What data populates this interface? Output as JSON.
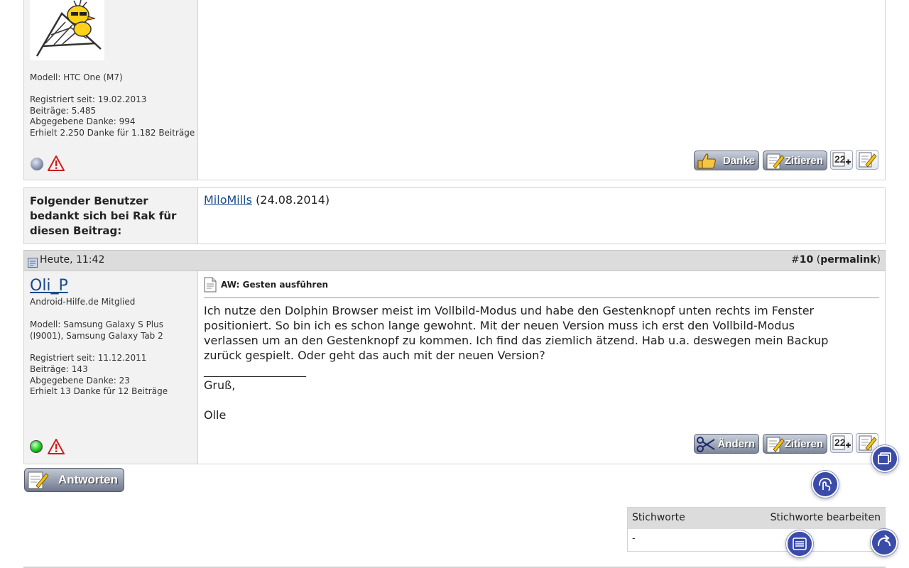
{
  "post_prev": {
    "info": {
      "model": "Modell: HTC One (M7)",
      "registered": "Registriert seit: 19.02.2013",
      "posts": "Beiträge: 5.485",
      "given_thanks": "Abgegebene Danke: 994",
      "received_thanks": "Erhielt 2.250 Danke für 1.182 Beiträge"
    },
    "buttons": {
      "thanks": "Danke",
      "quote": "Zitieren"
    }
  },
  "thanks_box": {
    "label": "Folgender Benutzer bedankt sich bei Rak für diesen Beitrag:",
    "user": "MiloMills",
    "date": "(24.08.2014)"
  },
  "post": {
    "date": "Heute, 11:42",
    "number_prefix": "#",
    "number": "10",
    "permalink_open": "(",
    "permalink": "permalink",
    "permalink_close": ")",
    "username": "Oli_P",
    "rank": "Android-Hilfe.de Mitglied",
    "info": {
      "model_line1": "Modell: Samsung Galaxy S Plus",
      "model_line2": "(I9001), Samsung Galaxy Tab 2",
      "registered": "Registriert seit: 11.12.2011",
      "posts": "Beiträge: 143",
      "given_thanks": "Abgegebene Danke: 23",
      "received_thanks": "Erhielt 13 Danke für 12 Beiträge"
    },
    "title": "AW: Gesten ausführen",
    "body": "Ich nutze den Dolphin Browser meist im Vollbild-Modus und habe den Gestenknopf unten rechts im Fenster positioniert. So bin ich es schon lange gewohnt. Mit der neuen Version muss ich erst den Vollbild-Modus verlassen um an den Gestenknopf zu kommen. Ich find das ziemlich ätzend. Hab u.a. deswegen mein Backup zurück gespielt. Oder geht das auch mit der neuen Version?",
    "signature_line": "__________________",
    "signature_greeting": "Gruß,",
    "signature_name": "Olle",
    "buttons": {
      "edit": "Ändern",
      "quote": "Zitieren"
    }
  },
  "reply_button": "Antworten",
  "tags": {
    "header": "Stichworte",
    "edit_link": "Stichworte bearbeiten",
    "value": "-"
  },
  "icons": {
    "status_offline": "offline-status-icon",
    "status_online": "online-status-icon",
    "report": "report-warning-icon",
    "multiquote": "multiquote-icon",
    "quick_reply": "quick-reply-icon",
    "tabs": "tabs-icon",
    "gesture": "gesture-icon",
    "menu": "menu-icon",
    "back": "back-icon"
  },
  "colors": {
    "link": "#1a4a8c",
    "panel": "#f2f2f2",
    "header": "#dcdcdc",
    "fab": "#3a4ba8",
    "online": "#18c818"
  }
}
